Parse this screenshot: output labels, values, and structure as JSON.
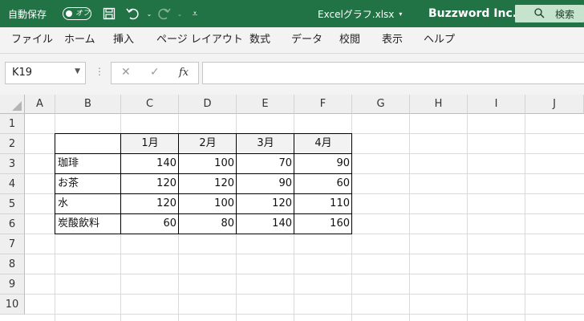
{
  "titlebar": {
    "autosave_label": "自動保存",
    "autosave_state": "オフ",
    "document_title": "Excelグラフ.xlsx",
    "company": "Buzzword Inc.",
    "search_label": "検索",
    "bg_color": "#217346"
  },
  "ribbon": {
    "tabs": [
      "ファイル",
      "ホーム",
      "挿入",
      "ページ レイアウト",
      "数式",
      "データ",
      "校閲",
      "表示",
      "ヘルプ"
    ]
  },
  "formula_bar": {
    "name_box": "K19",
    "fx_label": "fx",
    "formula": ""
  },
  "sheet": {
    "columns": [
      "A",
      "B",
      "C",
      "D",
      "E",
      "F",
      "G",
      "H",
      "I",
      "J"
    ],
    "rows": [
      "1",
      "2",
      "3",
      "4",
      "5",
      "6",
      "7",
      "8",
      "9",
      "10"
    ],
    "table": {
      "headers": [
        "",
        "1月",
        "2月",
        "3月",
        "4月"
      ],
      "rows": [
        [
          "珈琲",
          "140",
          "100",
          "70",
          "90"
        ],
        [
          "お茶",
          "120",
          "120",
          "90",
          "60"
        ],
        [
          "水",
          "120",
          "100",
          "120",
          "110"
        ],
        [
          "炭酸飲料",
          "60",
          "80",
          "140",
          "160"
        ]
      ]
    }
  }
}
